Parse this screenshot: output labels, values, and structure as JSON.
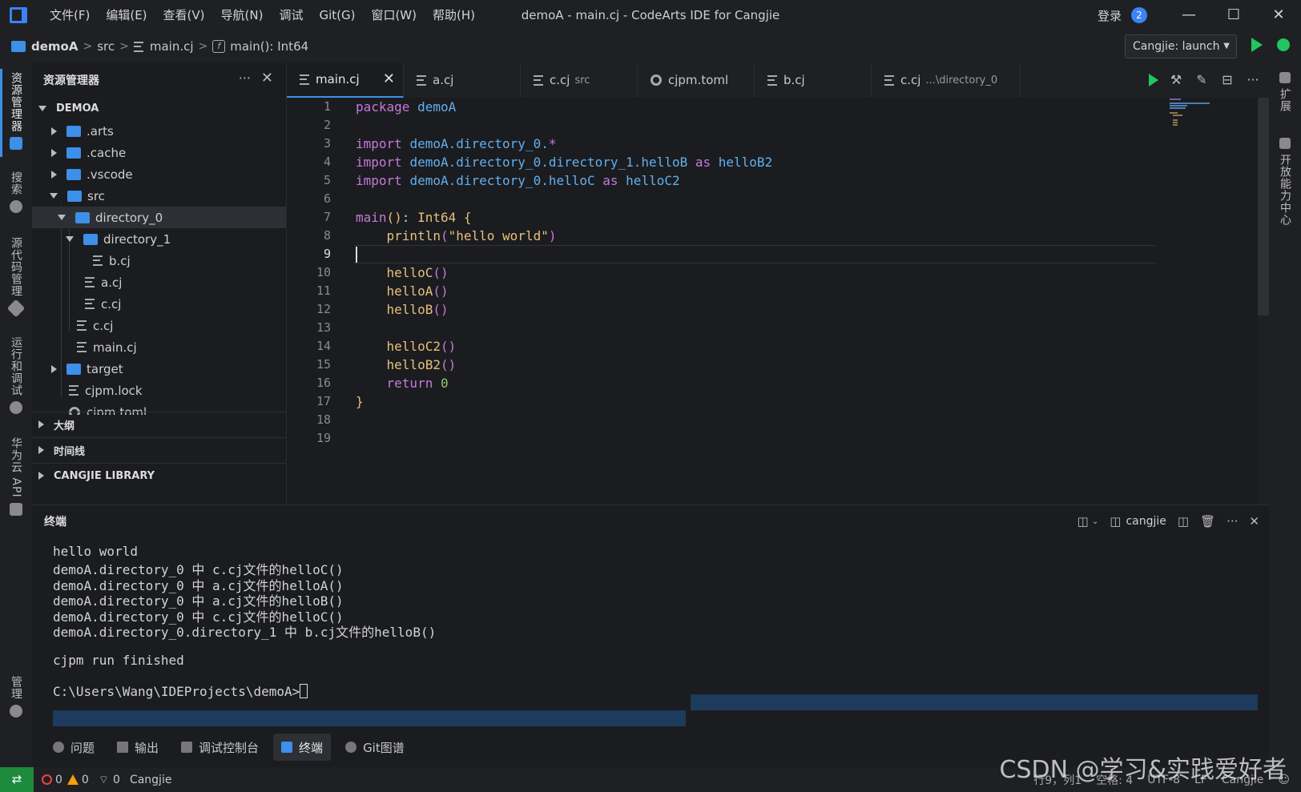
{
  "titlebar": {
    "menu": [
      "文件(F)",
      "编辑(E)",
      "查看(V)",
      "导航(N)",
      "调试",
      "Git(G)",
      "窗口(W)",
      "帮助(H)"
    ],
    "window_title": "demoA - main.cj - CodeArts IDE for Cangjie",
    "login": "登录",
    "notification_count": "2",
    "minimize": "—",
    "maximize": "☐",
    "close": "✕"
  },
  "breadcrumb": {
    "root": "demoA",
    "src": "src",
    "file": "main.cj",
    "symbol": "main(): Int64",
    "launch_config": "Cangjie: launch"
  },
  "activity": {
    "explorer": "资源管理器",
    "search": "搜索",
    "scm": "源代码管理",
    "run_debug": "运行和调试",
    "huawei_api": "华为云 API",
    "manage": "管理"
  },
  "rightbar": {
    "extensions": "扩展",
    "dev_center": "开放能力中心"
  },
  "sidebar": {
    "title": "资源管理器",
    "more": "···",
    "close": "✕",
    "root": "DEMOA",
    "tree": [
      ".arts",
      ".cache",
      ".vscode",
      "src",
      "directory_0",
      "directory_1",
      "b.cj",
      "a.cj",
      "c.cj",
      "c.cj",
      "main.cj",
      "target",
      "cjpm.lock",
      "cjpm.toml"
    ],
    "sections": [
      "大纲",
      "时间线",
      "CANGJIE LIBRARY"
    ]
  },
  "tabs": [
    {
      "label": "main.cj",
      "sub": ""
    },
    {
      "label": "a.cj",
      "sub": ""
    },
    {
      "label": "c.cj",
      "sub": "src"
    },
    {
      "label": "cjpm.toml",
      "sub": ""
    },
    {
      "label": "b.cj",
      "sub": ""
    },
    {
      "label": "c.cj",
      "sub": "...\\directory_0"
    }
  ],
  "editor": {
    "line_numbers": [
      "1",
      "2",
      "3",
      "4",
      "5",
      "6",
      "7",
      "8",
      "9",
      "10",
      "11",
      "12",
      "13",
      "14",
      "15",
      "16",
      "17",
      "18",
      "19"
    ],
    "current_line": 9
  },
  "panel": {
    "title": "终端",
    "terminal_name": "cangjie",
    "lines": [
      "hello world",
      "demoA.directory_0 中 c.cj文件的helloC()",
      "demoA.directory_0 中 a.cj文件的helloA()",
      "demoA.directory_0 中 a.cj文件的helloB()",
      "demoA.directory_0 中 c.cj文件的helloC()",
      "demoA.directory_0.directory_1 中 b.cj文件的helloB()",
      "",
      "cjpm run finished",
      "",
      "C:\\Users\\Wang\\IDEProjects\\demoA>"
    ]
  },
  "panel_tabs": [
    "问题",
    "输出",
    "调试控制台",
    "终端",
    "Git图谱"
  ],
  "statusbar": {
    "errors": "0",
    "warnings": "0",
    "ports": "0",
    "language": "Cangjie",
    "position": "行9，列1",
    "spaces": "空格: 4",
    "encoding": "UTF-8",
    "eol": "LF",
    "lang_mode": "Cangjie"
  },
  "watermark": "CSDN @学习&实践爱好者",
  "colors": {
    "accent": "#3d8fe8",
    "run": "#22c55e",
    "remote": "#1e8a3c"
  }
}
